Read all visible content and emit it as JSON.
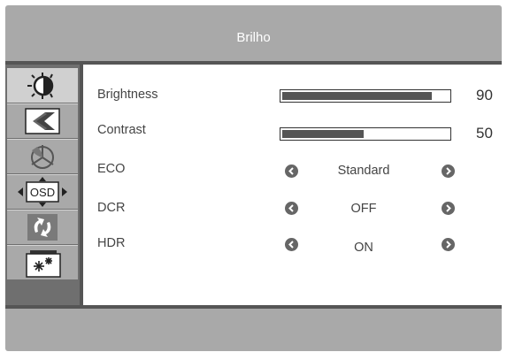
{
  "header": {
    "title": "Brilho"
  },
  "sidebar": {
    "items": [
      {
        "icon": "brightness-icon",
        "active": true
      },
      {
        "icon": "picture-icon"
      },
      {
        "icon": "color-icon"
      },
      {
        "icon": "osd-settings-icon",
        "label": "OSD"
      },
      {
        "icon": "reset-icon"
      },
      {
        "icon": "misc-icon"
      }
    ]
  },
  "settings": {
    "brightness": {
      "label": "Brightness",
      "value": 90,
      "level": 0.9
    },
    "contrast": {
      "label": "Contrast",
      "value": 50,
      "level": 0.5
    },
    "eco": {
      "label": "ECO",
      "value": "Standard"
    },
    "dcr": {
      "label": "DCR",
      "value": "OFF"
    },
    "hdr": {
      "label": "HDR",
      "value": "ON"
    }
  },
  "colors": {
    "panel": "#a9a9a9",
    "dark": "#555555",
    "active": "#d0d0d0"
  }
}
